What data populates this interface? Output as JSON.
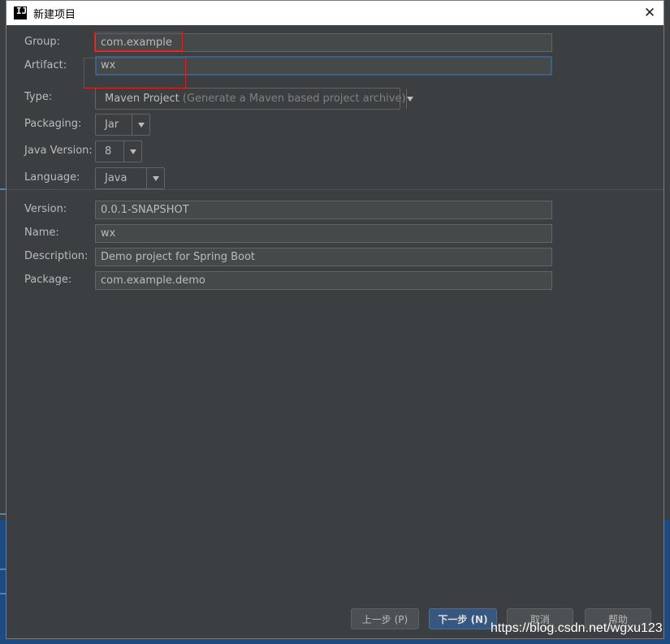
{
  "window": {
    "title": "新建项目",
    "app_icon_text": "IJ"
  },
  "form": {
    "group": {
      "label": "Group:",
      "value": "com.example"
    },
    "artifact": {
      "label": "Artifact:",
      "value": "wx"
    },
    "type": {
      "label": "Type:",
      "value": "Maven Project",
      "hint": "(Generate a Maven based project archive)"
    },
    "packaging": {
      "label": "Packaging:",
      "value": "Jar"
    },
    "java_version": {
      "label": "Java Version:",
      "value": "8"
    },
    "language": {
      "label": "Language:",
      "value": "Java"
    },
    "version": {
      "label": "Version:",
      "value": "0.0.1-SNAPSHOT"
    },
    "name": {
      "label": "Name:",
      "value": "wx"
    },
    "description": {
      "label": "Description:",
      "value": "Demo project for Spring Boot"
    },
    "package": {
      "label": "Package:",
      "value": "com.example.demo"
    }
  },
  "buttons": {
    "previous": "上一步 (P)",
    "next": "下一步 (N)",
    "cancel": "取消",
    "help": "帮助"
  },
  "watermark": "https://blog.csdn.net/wgxu123",
  "colors": {
    "dialog_bg": "#3c3f41",
    "field_bg": "#45494a",
    "focus_border": "#3d6185",
    "primary_button": "#365880",
    "annotation_red": "#e02020"
  }
}
